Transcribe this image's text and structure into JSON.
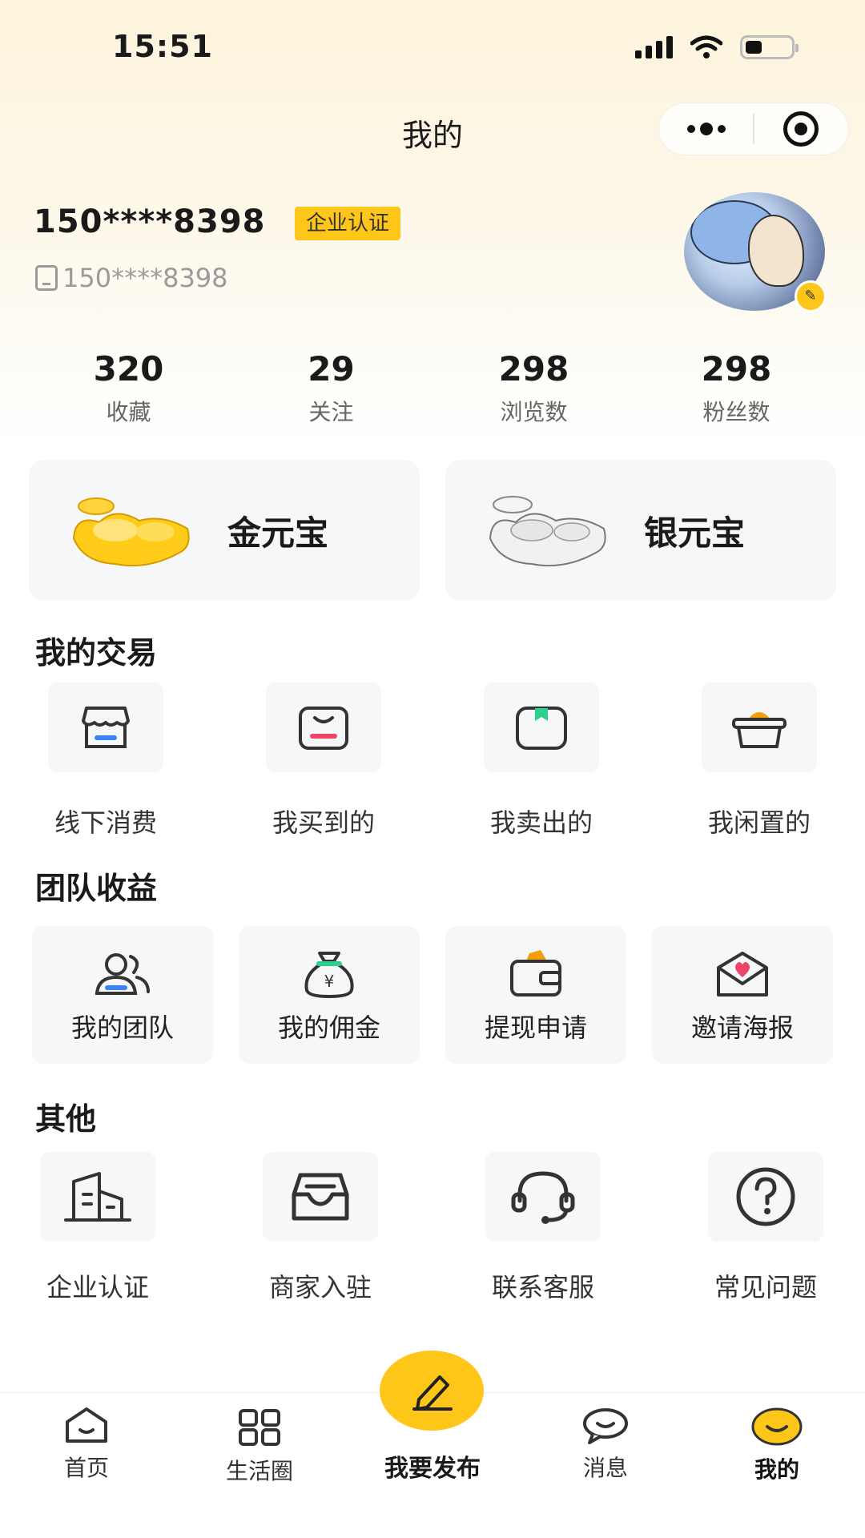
{
  "status_bar": {
    "time": "15:51"
  },
  "nav": {
    "title": "我的"
  },
  "profile": {
    "name": "150****8398",
    "badge": "企业认证",
    "phone": "150****8398"
  },
  "stats": [
    {
      "value": "320",
      "label": "收藏"
    },
    {
      "value": "29",
      "label": "关注"
    },
    {
      "value": "298",
      "label": "浏览数"
    },
    {
      "value": "298",
      "label": "粉丝数"
    }
  ],
  "ingots": {
    "gold": "金元宝",
    "silver": "银元宝"
  },
  "sections": {
    "transactions": {
      "title": "我的交易",
      "items": [
        "线下消费",
        "我买到的",
        "我卖出的",
        "我闲置的"
      ]
    },
    "team": {
      "title": "团队收益",
      "items": [
        "我的团队",
        "我的佣金",
        "提现申请",
        "邀请海报"
      ]
    },
    "other": {
      "title": "其他",
      "items": [
        "企业认证",
        "商家入驻",
        "联系客服",
        "常见问题"
      ]
    }
  },
  "tabbar": {
    "items": [
      "首页",
      "生活圈",
      "我要发布",
      "消息",
      "我的"
    ],
    "active": "我的"
  },
  "colors": {
    "accent": "#ffc61a",
    "card_bg": "#f6f7f9"
  }
}
